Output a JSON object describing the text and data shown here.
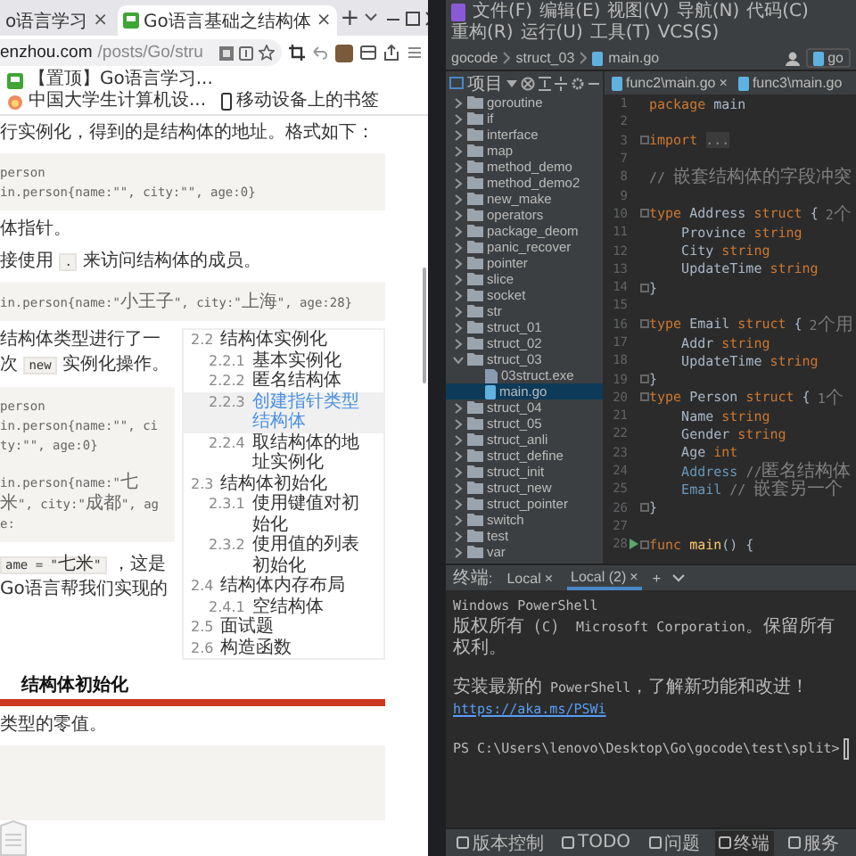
{
  "browser": {
    "tabs": [
      {
        "title": "o语言学习",
        "close": "×",
        "selected": false
      },
      {
        "title": "Go语言基础之结构体",
        "close": "×",
        "selected": true
      }
    ],
    "new_tab": "+",
    "address": {
      "domain": "enzhou.com",
      "path": "/posts/Go/stru"
    },
    "bookmarks": [
      {
        "title": "【置顶】Go语言学习..."
      },
      {
        "title": "中国大学生计算机设..."
      }
    ],
    "mobile_bookmarks": "移动设备上的书签",
    "article": {
      "before": [
        {
          "kind": "para",
          "parts": [
            {
              "kind": "text",
              "s": "行实例化，得到的是结构体的地址。格式如下："
            }
          ]
        },
        {
          "kind": "code",
          "groups": [
            [
              "person",
              "in.person{name:\"\", city:\"\", age:0}"
            ]
          ]
        },
        {
          "kind": "para",
          "parts": [
            {
              "kind": "text",
              "s": "体指针。"
            }
          ]
        },
        {
          "kind": "para",
          "parts": [
            {
              "kind": "text",
              "s": "接使用 "
            },
            {
              "kind": "code",
              "s": "."
            },
            {
              "kind": "text",
              "s": " 来访问结构体的成员。"
            }
          ]
        },
        {
          "kind": "code",
          "groups": [
            [
              "in.person{name:\"小王子\", city:\"上海\", age:28}"
            ]
          ]
        }
      ],
      "beside_toc": [
        {
          "kind": "para",
          "parts": [
            {
              "kind": "text",
              "s": "结构体类型进行了一次 "
            },
            {
              "kind": "code",
              "s": "new"
            },
            {
              "kind": "text",
              "s": " 实例化操作。"
            }
          ]
        },
        {
          "kind": "code",
          "groups": [
            [
              "person",
              "in.person{name:\"\", city:\"\", age:0}"
            ],
            [
              "in.person{name:\"七米\", city:\"成都\", age:"
            ]
          ]
        },
        {
          "kind": "para",
          "parts": [
            {
              "kind": "code",
              "s": "ame = \"七米\""
            },
            {
              "kind": "text",
              "s": " ，这是Go语言帮我们实现的"
            }
          ]
        }
      ],
      "after": [
        {
          "kind": "heading",
          "parts": [
            {
              "kind": "text",
              "s": "结构体初始化"
            }
          ]
        },
        {
          "kind": "para",
          "parts": [
            {
              "kind": "text",
              "s": "类型的零值。"
            }
          ]
        }
      ]
    },
    "toc": [
      {
        "num": "2.2",
        "title": "结构体实例化",
        "selected": false,
        "children": [
          {
            "num": "2.2.1",
            "title": "基本实例化",
            "selected": false
          },
          {
            "num": "2.2.2",
            "title": "匿名结构体",
            "selected": false
          },
          {
            "num": "2.2.3",
            "title": "创建指针类型结构体",
            "selected": true
          },
          {
            "num": "2.2.4",
            "title": "取结构体的地址实例化",
            "selected": false
          }
        ]
      },
      {
        "num": "2.3",
        "title": "结构体初始化",
        "selected": false,
        "children": [
          {
            "num": "2.3.1",
            "title": "使用键值对初始化",
            "selected": false
          },
          {
            "num": "2.3.2",
            "title": "使用值的列表初始化",
            "selected": false
          }
        ]
      },
      {
        "num": "2.4",
        "title": "结构体内存布局",
        "selected": false,
        "children": [
          {
            "num": "2.4.1",
            "title": "空结构体",
            "selected": false
          }
        ]
      },
      {
        "num": "2.5",
        "title": "面试题",
        "selected": false
      },
      {
        "num": "2.6",
        "title": "构造函数",
        "selected": false
      }
    ]
  },
  "ide": {
    "menu": [
      "文件(F)",
      "编辑(E)",
      "视图(V)",
      "导航(N)",
      "代码(C)",
      "重构(R)",
      "运行(U)",
      "工具(T)",
      "VCS(S)"
    ],
    "breadcrumb": [
      "gocode",
      "struct_03",
      "main.go"
    ],
    "run_config": "go",
    "project": {
      "title": "项目",
      "tree": [
        {
          "name": "goroutine",
          "kind": "folder",
          "expanded": false,
          "selected": false
        },
        {
          "name": "if",
          "kind": "folder",
          "expanded": false,
          "selected": false
        },
        {
          "name": "interface",
          "kind": "folder",
          "expanded": false,
          "selected": false
        },
        {
          "name": "map",
          "kind": "folder",
          "expanded": false,
          "selected": false
        },
        {
          "name": "method_demo",
          "kind": "folder",
          "expanded": false,
          "selected": false
        },
        {
          "name": "method_demo2",
          "kind": "folder",
          "expanded": false,
          "selected": false
        },
        {
          "name": "new_make",
          "kind": "folder",
          "expanded": false,
          "selected": false
        },
        {
          "name": "operators",
          "kind": "folder",
          "expanded": false,
          "selected": false
        },
        {
          "name": "package_deom",
          "kind": "folder",
          "expanded": false,
          "selected": false
        },
        {
          "name": "panic_recover",
          "kind": "folder",
          "expanded": false,
          "selected": false
        },
        {
          "name": "pointer",
          "kind": "folder",
          "expanded": false,
          "selected": false
        },
        {
          "name": "slice",
          "kind": "folder",
          "expanded": false,
          "selected": false
        },
        {
          "name": "socket",
          "kind": "folder",
          "expanded": false,
          "selected": false
        },
        {
          "name": "str",
          "kind": "folder",
          "expanded": false,
          "selected": false
        },
        {
          "name": "struct_01",
          "kind": "folder",
          "expanded": false,
          "selected": false
        },
        {
          "name": "struct_02",
          "kind": "folder",
          "expanded": false,
          "selected": false
        },
        {
          "name": "struct_03",
          "kind": "folder",
          "expanded": true,
          "selected": false,
          "children": [
            {
              "name": "03struct.exe",
              "kind": "exe",
              "selected": false
            },
            {
              "name": "main.go",
              "kind": "go",
              "selected": true
            }
          ]
        },
        {
          "name": "struct_04",
          "kind": "folder",
          "expanded": false,
          "selected": false
        },
        {
          "name": "struct_05",
          "kind": "folder",
          "expanded": false,
          "selected": false
        },
        {
          "name": "struct_anli",
          "kind": "folder",
          "expanded": false,
          "selected": false
        },
        {
          "name": "struct_define",
          "kind": "folder",
          "expanded": false,
          "selected": false
        },
        {
          "name": "struct_init",
          "kind": "folder",
          "expanded": false,
          "selected": false
        },
        {
          "name": "struct_new",
          "kind": "folder",
          "expanded": false,
          "selected": false
        },
        {
          "name": "struct_pointer",
          "kind": "folder",
          "expanded": false,
          "selected": false
        },
        {
          "name": "switch",
          "kind": "folder",
          "expanded": false,
          "selected": false
        },
        {
          "name": "test",
          "kind": "folder",
          "expanded": false,
          "selected": false
        },
        {
          "name": "var",
          "kind": "folder",
          "expanded": false,
          "selected": false
        }
      ]
    },
    "editor_tabs": [
      {
        "title": "func2\\main.go",
        "close": "×"
      },
      {
        "title": "func3\\main.go"
      }
    ],
    "code": [
      {
        "n": "1",
        "fold": false,
        "run": false,
        "tokens": [
          {
            "kind": "kw",
            "s": "package "
          },
          {
            "kind": "plain",
            "s": "main"
          }
        ]
      },
      {
        "n": "2",
        "fold": false,
        "run": false
      },
      {
        "n": "3",
        "fold": true,
        "run": false,
        "tokens": [
          {
            "kind": "kw",
            "s": "import "
          },
          {
            "kind": "folded",
            "s": "..."
          }
        ]
      },
      {
        "n": "7",
        "fold": false,
        "run": false
      },
      {
        "n": "8",
        "fold": false,
        "run": false,
        "tokens": [
          {
            "kind": "comment",
            "s": "// 嵌套结构体的字段冲突"
          }
        ]
      },
      {
        "n": "9",
        "fold": false,
        "run": false
      },
      {
        "n": "10",
        "fold": true,
        "run": false,
        "tokens": [
          {
            "kind": "kw",
            "s": "type "
          },
          {
            "kind": "plain",
            "s": "Address "
          },
          {
            "kind": "kw",
            "s": "struct "
          },
          {
            "kind": "plain",
            "s": "{"
          },
          {
            "kind": "hint",
            "s": "2个"
          }
        ]
      },
      {
        "n": "11",
        "fold": false,
        "run": false,
        "tokens": [
          {
            "kind": "plain",
            "s": "    Province "
          },
          {
            "kind": "kw",
            "s": "string"
          }
        ]
      },
      {
        "n": "12",
        "fold": false,
        "run": false,
        "tokens": [
          {
            "kind": "plain",
            "s": "    City "
          },
          {
            "kind": "kw",
            "s": "string"
          }
        ]
      },
      {
        "n": "13",
        "fold": false,
        "run": false,
        "tokens": [
          {
            "kind": "plain",
            "s": "    UpdateTime "
          },
          {
            "kind": "kw",
            "s": "string"
          }
        ]
      },
      {
        "n": "14",
        "fold": true,
        "run": false,
        "tokens": [
          {
            "kind": "plain",
            "s": "}"
          }
        ]
      },
      {
        "n": "15",
        "fold": false,
        "run": false
      },
      {
        "n": "16",
        "fold": true,
        "run": false,
        "tokens": [
          {
            "kind": "kw",
            "s": "type "
          },
          {
            "kind": "plain",
            "s": "Email "
          },
          {
            "kind": "kw",
            "s": "struct "
          },
          {
            "kind": "plain",
            "s": "{"
          },
          {
            "kind": "hint",
            "s": "2个用"
          }
        ]
      },
      {
        "n": "17",
        "fold": false,
        "run": false,
        "tokens": [
          {
            "kind": "plain",
            "s": "    Addr "
          },
          {
            "kind": "kw",
            "s": "string"
          }
        ]
      },
      {
        "n": "18",
        "fold": false,
        "run": false,
        "tokens": [
          {
            "kind": "plain",
            "s": "    UpdateTime "
          },
          {
            "kind": "kw",
            "s": "string"
          }
        ]
      },
      {
        "n": "19",
        "fold": true,
        "run": false,
        "tokens": [
          {
            "kind": "plain",
            "s": "}"
          }
        ]
      },
      {
        "n": "20",
        "fold": true,
        "run": false,
        "tokens": [
          {
            "kind": "kw",
            "s": "type "
          },
          {
            "kind": "plain",
            "s": "Person "
          },
          {
            "kind": "kw",
            "s": "struct "
          },
          {
            "kind": "plain",
            "s": "{"
          },
          {
            "kind": "hint",
            "s": "1个"
          }
        ]
      },
      {
        "n": "21",
        "fold": false,
        "run": false,
        "tokens": [
          {
            "kind": "plain",
            "s": "    Name "
          },
          {
            "kind": "kw",
            "s": "string"
          }
        ]
      },
      {
        "n": "22",
        "fold": false,
        "run": false,
        "tokens": [
          {
            "kind": "plain",
            "s": "    Gender "
          },
          {
            "kind": "kw",
            "s": "string"
          }
        ]
      },
      {
        "n": "23",
        "fold": false,
        "run": false,
        "tokens": [
          {
            "kind": "plain",
            "s": "    Age "
          },
          {
            "kind": "kw",
            "s": "int"
          }
        ]
      },
      {
        "n": "24",
        "fold": false,
        "run": false,
        "tokens": [
          {
            "kind": "embed",
            "s": "    Address "
          },
          {
            "kind": "comment",
            "s": "//匿名结构体"
          }
        ]
      },
      {
        "n": "25",
        "fold": false,
        "run": false,
        "tokens": [
          {
            "kind": "embed",
            "s": "    Email "
          },
          {
            "kind": "comment",
            "s": "// 嵌套另一个"
          }
        ]
      },
      {
        "n": "26",
        "fold": true,
        "run": false,
        "tokens": [
          {
            "kind": "plain",
            "s": "}"
          }
        ]
      },
      {
        "n": "27",
        "fold": false,
        "run": false
      },
      {
        "n": "28",
        "fold": true,
        "run": true,
        "tokens": [
          {
            "kind": "kw",
            "s": "func "
          },
          {
            "kind": "func",
            "s": "main"
          },
          {
            "kind": "plain",
            "s": "() {"
          }
        ]
      }
    ],
    "terminal": {
      "title": "终端:",
      "tabs": [
        {
          "title": "Local",
          "close": "×",
          "selected": false
        },
        {
          "title": "Local (2)",
          "close": "×",
          "selected": true
        }
      ],
      "new_tab": "+",
      "lines": [
        {
          "text": "Windows PowerShell"
        },
        {
          "text": "版权所有（C） Microsoft Corporation。保留所有权利。"
        },
        {
          "text": "安装最新的 PowerShell，了解新功能和改进！",
          "link": "https://aka.ms/PSWi"
        }
      ],
      "prompt": "PS C:\\Users\\lenovo\\Desktop\\Go\\gocode\\test\\split>"
    },
    "tool_windows": [
      {
        "title": "版本控制",
        "selected": false
      },
      {
        "title": "TODO",
        "selected": false
      },
      {
        "title": "问题",
        "selected": false
      },
      {
        "title": "终端",
        "selected": true
      },
      {
        "title": "服务",
        "selected": false
      }
    ]
  }
}
